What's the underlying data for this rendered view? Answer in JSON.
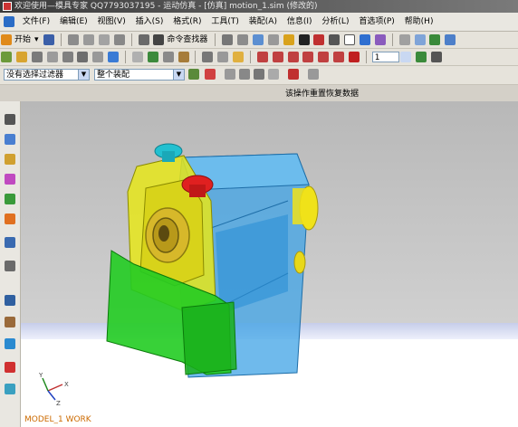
{
  "window": {
    "title": "欢迎使用—模具专家 QQ7793037195 - 运动仿真 - [仿真] motion_1.sim (修改的)"
  },
  "menu": {
    "items": [
      "文件(F)",
      "编辑(E)",
      "视图(V)",
      "插入(S)",
      "格式(R)",
      "工具(T)",
      "装配(A)",
      "信息(I)",
      "分析(L)",
      "首选项(P)",
      "帮助(H)"
    ]
  },
  "toolbar1": {
    "start_label": "开始",
    "command_finder_label": "命令查找器"
  },
  "toolbar2": {
    "frame_value": "1"
  },
  "toolbar3": {
    "filter_value": "没有选择过滤器",
    "assembly_value": "整个装配"
  },
  "hint": {
    "text": "该操作重置恢复数据"
  },
  "status": {
    "text": "MODEL_1 WORK"
  },
  "axis": {
    "x_label": "X",
    "y_label": "Y",
    "z_label": "Z"
  },
  "colors": {
    "viewport_bg_top": "#bdbdbd",
    "viewport_floor": "#ffffff",
    "horizon_band": "#cfd6ee",
    "body_blue": "#3fa3e6",
    "part_yellow": "#e6e61a",
    "part_green": "#22cc22",
    "knob_red": "#e02020",
    "knob_cyan": "#22c0d0",
    "status_text": "#cc6a00"
  }
}
